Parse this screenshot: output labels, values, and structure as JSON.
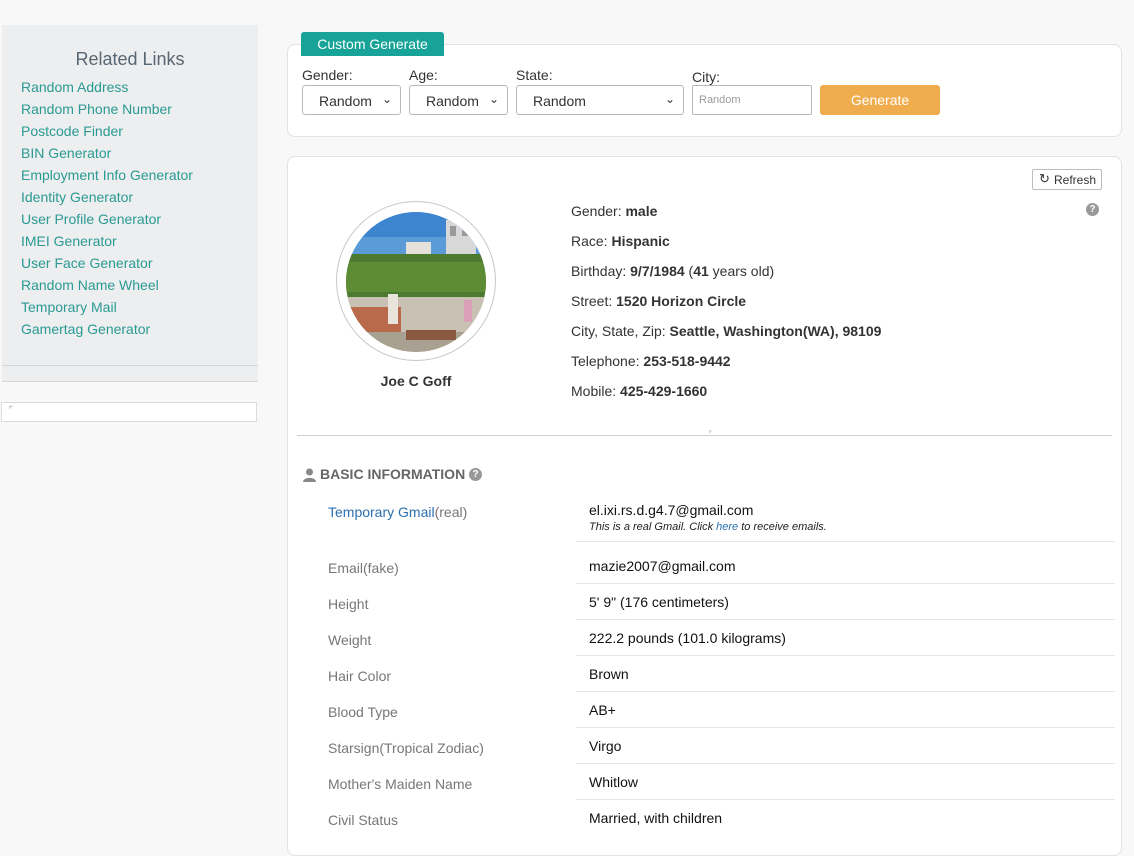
{
  "sidebar": {
    "title": "Related Links",
    "links": [
      "Random Address",
      "Random Phone Number",
      "Postcode Finder",
      "BIN Generator",
      "Employment Info Generator",
      "Identity Generator",
      "User Profile Generator",
      "IMEI Generator",
      "User Face Generator",
      "Random Name Wheel",
      "Temporary Mail",
      "Gamertag Generator"
    ]
  },
  "generator": {
    "tab_label": "Custom Generate",
    "gender_label": "Gender:",
    "gender_value": "Random",
    "age_label": "Age:",
    "age_value": "Random",
    "state_label": "State:",
    "state_value": "Random",
    "city_label": "City:",
    "city_placeholder": "Random",
    "generate_label": "Generate"
  },
  "profile": {
    "refresh_label": "Refresh",
    "name": "Joe C Goff",
    "fields": [
      {
        "label": "Gender: ",
        "value": "male"
      },
      {
        "label": "Race: ",
        "value": "Hispanic"
      },
      {
        "label": "Birthday: ",
        "value": "9/7/1984",
        "extra_open": " (",
        "age": "41",
        "extra_close": " years old)"
      },
      {
        "label": "Street: ",
        "value": "1520 Horizon Circle"
      },
      {
        "label": "City, State, Zip: ",
        "value": "Seattle, Washington(WA), 98109"
      },
      {
        "label": "Telephone: ",
        "value": "253-518-9442"
      },
      {
        "label": "Mobile: ",
        "value": "425-429-1660"
      }
    ]
  },
  "basic": {
    "title": "BASIC INFORMATION",
    "gmail_link": "Temporary Gmail",
    "gmail_suffix": "(real)",
    "gmail_value": "el.ixi.rs.d.g4.7@gmail.com",
    "note_prefix": "This is a real Gmail. Click ",
    "note_link": "here",
    "note_suffix": " to receive emails.",
    "rows": [
      {
        "label": "Email(fake)",
        "value": "mazie2007@gmail.com"
      },
      {
        "label": "Height",
        "value": "5' 9\" (176 centimeters)"
      },
      {
        "label": "Weight",
        "value": "222.2 pounds (101.0 kilograms)"
      },
      {
        "label": "Hair Color",
        "value": "Brown"
      },
      {
        "label": "Blood Type",
        "value": "AB+"
      },
      {
        "label": "Starsign(Tropical Zodiac)",
        "value": "Virgo"
      },
      {
        "label": "Mother's Maiden Name",
        "value": "Whitlow"
      },
      {
        "label": "Civil Status",
        "value": "Married, with children"
      }
    ]
  }
}
